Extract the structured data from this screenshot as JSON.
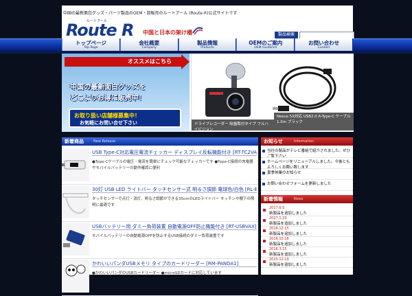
{
  "header": {
    "tagline": "中国の最新面白グッズ・パーツ製品のOEM・卸販売のルートアール (Route-R)公式サイトです",
    "logo_text": "Route R",
    "logo_sub": "ルートアール",
    "catch": "中国と日本の架け橋",
    "search_label": "製品検索",
    "search_placeholder": ""
  },
  "nav": [
    {
      "label": "トップページ",
      "sub": "Top Page"
    },
    {
      "label": "会社概要",
      "sub": "Company"
    },
    {
      "label": "製品情報",
      "sub": "Products"
    },
    {
      "label": "OEMのご案内",
      "sub": "OEM Guidance"
    },
    {
      "label": "お問い合わせ",
      "sub": "Contact"
    }
  ],
  "hero": {
    "osusume": "オススメはこちら",
    "line1": "中国の最新面白グッズを",
    "line2": "どこよりお得に販売中！",
    "badge1": "お取り扱い店舗様募集中！",
    "badge2": "お気軽にお問い合せ下さい",
    "caption1": "ドライブレコーダー 吸盤取付タイプ フルハイビジョン",
    "caption2": "Nexus 5X対応 USB2.0 A-Type-C ケーブル 1.0m ブラック"
  },
  "new_products": {
    "title": "新着商品",
    "title_en": "New Release",
    "items": [
      {
        "title": "USB Type-C対応電圧電流チェッカー ディスプレイ反転機能付き [RT-TC2VASV]",
        "desc": "●Type-Cケーブルの電圧・電流を簡単にチェック可能なチェッカーです ●Type-C接続の充電器やモバイルバッテリーの動作確認に便利"
      },
      {
        "title": "30灯 USB LED ライトバー タッチセンサー式 明るさ調節 電球色/白色 [RL-BAR30DD/LD]",
        "desc": "タッチセンサーで点灯・消灯、明るさ調節ができる35cmのLEDライトバー キッチンや棚下の照明に最適です"
      },
      {
        "title": "USBバッテリー用 ダミー負荷装置 自動電源OFF防止機能付き [RT-USBVAX]",
        "desc": "モバイルバッテリーの自動電源OFFを防止するUSB接続のダミー負荷装置です"
      },
      {
        "title": "かわいいパンダUSBメモリ タイプのカードリーダー [RM-PANDA1]",
        "desc": "●かわいいパンダのUSBカードリーダー ●microSDカードに対応しています"
      }
    ]
  },
  "info": {
    "title": "お知らせ",
    "title_en": "Information",
    "items": [
      "当社の製品がテレビ番組で紹介されました。ぜひご覧下さい",
      "ホームページをリニューアルしました。今後ともよろしくお願い致します",
      "夏季休業のお知らせ",
      "お問い合わせフォームを更新しました"
    ]
  },
  "news": {
    "title": "新着情報",
    "title_en": "News",
    "items": [
      {
        "date": "2017.6.5",
        "text": "新製品を追加しました"
      },
      {
        "date": "2017.1.23",
        "text": "新製品を追加しました"
      },
      {
        "date": "2016.12.15",
        "text": "新製品を追加しました"
      },
      {
        "date": "2016.10.18",
        "text": "新製品を追加しました"
      },
      {
        "date": "2016.3.15",
        "text": "新製品を追加しました"
      },
      {
        "date": "2015.12.19",
        "text": "新製品を追加しました"
      }
    ]
  },
  "colors": {
    "brand_blue": "#163a8f",
    "accent_red": "#c51d1d",
    "background": "#0a0f1e"
  }
}
